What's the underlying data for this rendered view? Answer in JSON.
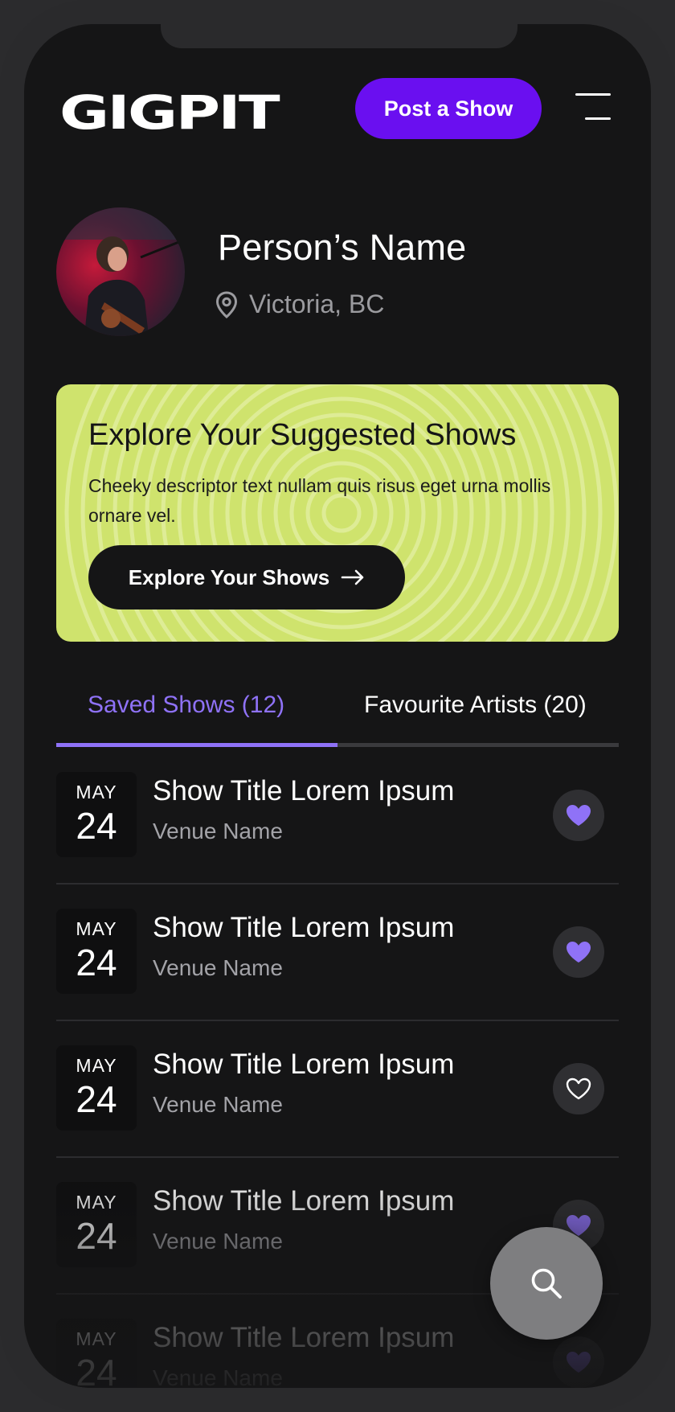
{
  "app": {
    "logo_text": "GIGPIT"
  },
  "header": {
    "post_button_label": "Post a Show",
    "menu_icon": "hamburger-menu-icon"
  },
  "profile": {
    "name": "Person’s Name",
    "location": "Victoria, BC",
    "location_icon": "map-pin-icon"
  },
  "promo": {
    "title": "Explore Your Suggested Shows",
    "description": "Cheeky descriptor text nullam quis risus eget urna mollis ornare vel.",
    "button_label": "Explore Your Shows",
    "button_icon": "arrow-right-icon"
  },
  "tabs": [
    {
      "label": "Saved Shows (12)",
      "active": true
    },
    {
      "label": "Favourite Artists (20)",
      "active": false
    }
  ],
  "shows": [
    {
      "month": "MAY",
      "day": "24",
      "title": "Show Title Lorem Ipsum",
      "venue": "Venue Name",
      "favourited": true
    },
    {
      "month": "MAY",
      "day": "24",
      "title": "Show Title Lorem Ipsum",
      "venue": "Venue Name",
      "favourited": true
    },
    {
      "month": "MAY",
      "day": "24",
      "title": "Show Title Lorem Ipsum",
      "venue": "Venue Name",
      "favourited": false
    },
    {
      "month": "MAY",
      "day": "24",
      "title": "Show Title Lorem Ipsum",
      "venue": "Venue Name",
      "favourited": true
    },
    {
      "month": "MAY",
      "day": "24",
      "title": "Show Title Lorem Ipsum",
      "venue": "Venue Name",
      "favourited": true
    }
  ],
  "fab": {
    "icon": "search-icon"
  },
  "colors": {
    "accent_purple": "#6a0ff0",
    "tab_active": "#8f72f7",
    "promo_bg": "#cfe36d",
    "screen_bg": "#151516"
  }
}
